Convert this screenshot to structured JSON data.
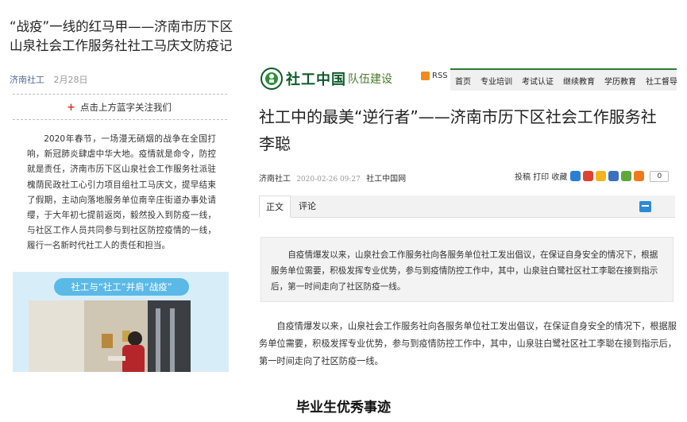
{
  "left_article": {
    "title": "“战疫”一线的红马甲——济南市历下区山泉社会工作服务社社工马庆文防疫记",
    "account": "济南社工",
    "date": "2月28日",
    "follow_prompt": "点击上方蓝字关注我们",
    "follow_icon": "plus-icon",
    "body": "2020年春节，一场漫无硝烟的战争在全国打响，新冠肺炎肆虐中华大地。疫情就是命令，防控就是责任，济南市历下区山泉社会工作服务社派驻槐荫民政社工心引力项目组社工马庆文，提早结束了假期，主动向落地服务单位南辛庄街道办事处请缨，于大年初七提前返岗，毅然投入到防疫一线，与社区工作人员共同参与到社区防控疫情的一线，履行一名新时代社工人的责任和担当。",
    "banner": "社工与“社工”并肩“战疫”"
  },
  "right_page": {
    "logo_text": "社工中国",
    "logo_sub": "队伍建设",
    "rss_label": "RSS",
    "nav": [
      "首页",
      "专业培训",
      "考试认证",
      "继续教育",
      "学历教育",
      "社工督导"
    ],
    "title": "社工中的最美“逆行者”——济南市历下区社会工作服务社李聪",
    "author": "济南社工",
    "time": "2020-02-26 09:27",
    "source": "社工中国网",
    "share_label": "投稿 打印 收藏",
    "share_count": "0",
    "tabs": [
      "正文",
      "评论"
    ],
    "summary": "自疫情爆发以来，山泉社会工作服务社向各服务单位社工发出倡议，在保证自身安全的情况下，根据服务单位需要，积极发挥专业优势，参与到疫情防控工作中，其中，山泉驻白鹭社区社工李聪在接到指示后，第一时间走向了社区防疫一线。",
    "body": "自疫情爆发以来，山泉社会工作服务社向各服务单位社工发出倡议，在保证自身安全的情况下，根据服务单位需要，积极发挥专业优势，参与到疫情防控工作中，其中，山泉驻白鹭社区社工李聪在接到指示后，第一时间走向了社区防疫一线。"
  },
  "caption": "毕业生优秀事迹",
  "colors": {
    "link_blue": "#576b95",
    "banner_blue": "#5ab9e6",
    "logo_green": "#0d5c2a",
    "accent_red": "#d4372c"
  }
}
